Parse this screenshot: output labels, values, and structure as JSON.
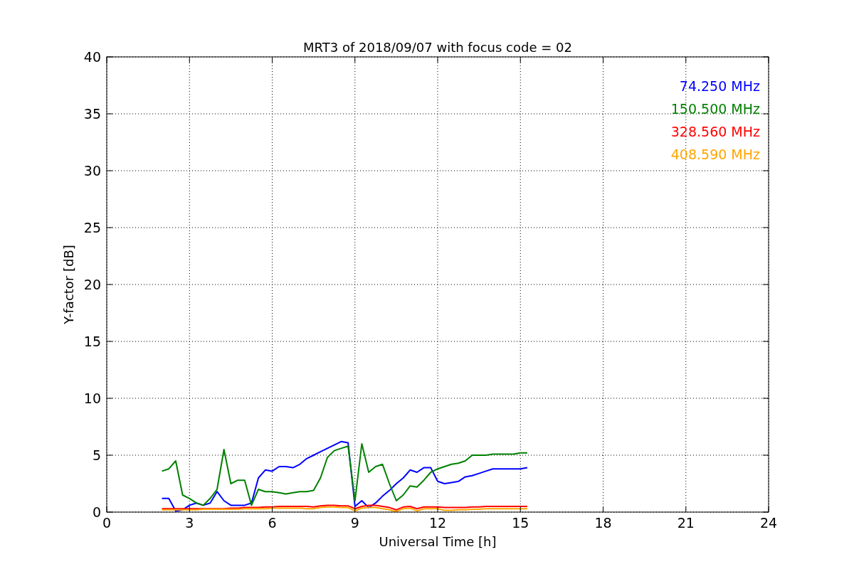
{
  "chart_data": {
    "type": "line",
    "title": "MRT3 of 2018/09/07 with focus code = 02",
    "xlabel": "Universal Time [h]",
    "ylabel": "Y-factor [dB]",
    "x": [
      2.0,
      2.25,
      2.5,
      2.75,
      3.0,
      3.25,
      3.5,
      3.75,
      4.0,
      4.25,
      4.5,
      4.75,
      5.0,
      5.25,
      5.5,
      5.75,
      6.0,
      6.25,
      6.5,
      6.75,
      7.0,
      7.25,
      7.5,
      7.75,
      8.0,
      8.25,
      8.5,
      8.75,
      9.0,
      9.25,
      9.5,
      9.75,
      10.0,
      10.25,
      10.5,
      10.75,
      11.0,
      11.25,
      11.5,
      11.75,
      12.0,
      12.25,
      12.5,
      12.75,
      13.0,
      13.25,
      13.5,
      13.75,
      14.0,
      14.25,
      14.5,
      14.75,
      15.0,
      15.25
    ],
    "series": [
      {
        "name": "74.250 MHz",
        "color": "#0000ff",
        "values": [
          1.2,
          1.2,
          0.1,
          0.2,
          0.6,
          0.8,
          0.6,
          0.8,
          1.8,
          1.0,
          0.6,
          0.6,
          0.6,
          0.8,
          3.0,
          3.7,
          3.6,
          4.0,
          4.0,
          3.9,
          4.2,
          4.7,
          5.0,
          5.3,
          5.6,
          5.9,
          6.2,
          6.1,
          0.5,
          1.0,
          0.4,
          0.8,
          1.4,
          1.9,
          2.5,
          3.0,
          3.7,
          3.5,
          3.9,
          3.9,
          2.7,
          2.5,
          2.6,
          2.7,
          3.1,
          3.2,
          3.4,
          3.6,
          3.8,
          3.8,
          3.8,
          3.8,
          3.8,
          3.9
        ]
      },
      {
        "name": "150.500 MHz",
        "color": "#008000",
        "values": [
          3.6,
          3.8,
          4.5,
          1.5,
          1.2,
          0.8,
          0.6,
          1.2,
          2.0,
          5.5,
          2.5,
          2.8,
          2.8,
          0.6,
          2.0,
          1.8,
          1.8,
          1.7,
          1.6,
          1.7,
          1.8,
          1.8,
          1.9,
          3.0,
          4.8,
          5.4,
          5.6,
          5.8,
          1.0,
          6.0,
          3.5,
          4.0,
          4.2,
          2.5,
          1.0,
          1.5,
          2.3,
          2.2,
          2.8,
          3.5,
          3.8,
          4.0,
          4.2,
          4.3,
          4.5,
          5.0,
          5.0,
          5.0,
          5.1,
          5.1,
          5.1,
          5.1,
          5.2,
          5.2
        ]
      },
      {
        "name": "328.560 MHz",
        "color": "#ff0000",
        "values": [
          0.3,
          0.3,
          0.3,
          0.3,
          0.3,
          0.3,
          0.3,
          0.3,
          0.3,
          0.3,
          0.35,
          0.35,
          0.4,
          0.4,
          0.4,
          0.45,
          0.45,
          0.5,
          0.5,
          0.5,
          0.5,
          0.5,
          0.45,
          0.55,
          0.6,
          0.6,
          0.55,
          0.55,
          0.3,
          0.5,
          0.6,
          0.6,
          0.5,
          0.4,
          0.2,
          0.45,
          0.5,
          0.3,
          0.45,
          0.45,
          0.45,
          0.4,
          0.4,
          0.4,
          0.4,
          0.45,
          0.45,
          0.5,
          0.5,
          0.5,
          0.5,
          0.5,
          0.5,
          0.5
        ]
      },
      {
        "name": "408.590 MHz",
        "color": "#ffa500",
        "values": [
          0.2,
          0.2,
          0.2,
          0.2,
          0.2,
          0.2,
          0.25,
          0.25,
          0.25,
          0.25,
          0.25,
          0.25,
          0.3,
          0.3,
          0.3,
          0.3,
          0.35,
          0.35,
          0.35,
          0.35,
          0.35,
          0.3,
          0.3,
          0.4,
          0.45,
          0.45,
          0.4,
          0.4,
          0.1,
          0.35,
          0.4,
          0.4,
          0.3,
          0.2,
          0.05,
          0.3,
          0.35,
          0.1,
          0.3,
          0.3,
          0.3,
          0.15,
          0.15,
          0.2,
          0.2,
          0.25,
          0.25,
          0.3,
          0.3,
          0.3,
          0.3,
          0.3,
          0.3,
          0.3
        ]
      }
    ],
    "grid": true,
    "xlim": [
      0,
      24
    ],
    "ylim": [
      0,
      40
    ],
    "xticks": [
      0,
      3,
      6,
      9,
      12,
      15,
      18,
      21,
      24
    ],
    "yticks": [
      0,
      5,
      10,
      15,
      20,
      25,
      30,
      35,
      40
    ]
  }
}
